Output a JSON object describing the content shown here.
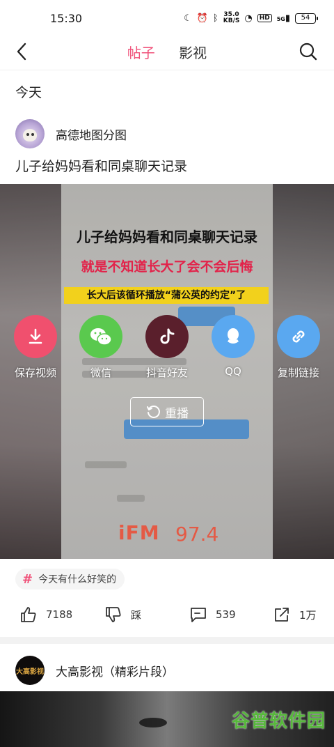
{
  "status": {
    "time": "15:30",
    "network_speed": "35.0",
    "network_unit": "KB/S",
    "hd": "HD",
    "signal": "5G",
    "battery": "54"
  },
  "nav": {
    "tabs": [
      {
        "label": "帖子",
        "active": true
      },
      {
        "label": "影视",
        "active": false
      }
    ]
  },
  "section_label": "今天",
  "post": {
    "author": "高德地图分图",
    "title": "儿子给妈妈看和同桌聊天记录",
    "video": {
      "caption_line1": "儿子给妈妈看和同桌聊天记录",
      "caption_line2": "就是不知道长大了会不会后悔",
      "caption_line3": "长大后该循环播放“蒲公英的约定”了",
      "logo_text": "iFM",
      "logo_number": "97.4"
    },
    "share_options": [
      {
        "label": "保存视频",
        "icon": "download-icon",
        "color": "#f0506e"
      },
      {
        "label": "微信",
        "icon": "wechat-icon",
        "color": "#5ac94e"
      },
      {
        "label": "抖音好友",
        "icon": "tiktok-icon",
        "color": "#5a1f2c"
      },
      {
        "label": "QQ",
        "icon": "qq-icon",
        "color": "#5aa8f0"
      },
      {
        "label": "复制链接",
        "icon": "link-icon",
        "color": "#5aa8f0"
      }
    ],
    "replay_label": "重播",
    "tag": "今天有什么好笑的",
    "actions": {
      "likes": "7188",
      "dislike_label": "踩",
      "comments": "539",
      "shares": "1万"
    }
  },
  "next_post": {
    "author": "大高影视（精彩片段）",
    "avatar_text": "大高影视"
  },
  "watermark": "谷普软件园",
  "colors": {
    "accent": "#f0527a"
  }
}
